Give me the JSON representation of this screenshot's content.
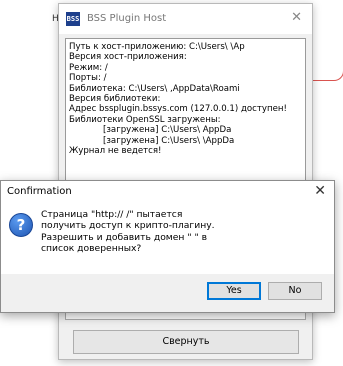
{
  "background": {
    "fragment_text": "Н"
  },
  "host": {
    "title": "BSS Plugin Host",
    "logo_text": "BSS",
    "log_lines": [
      "Путь к хост-приложению: C:\\Users\\             \\Ap",
      "Версия хост-приложения:",
      "Режим:      /",
      "Порты:      /",
      "Библиотека: C:\\Users\\                 ,AppData\\Roami",
      "Версия библиотеки:",
      "Адрес bssplugin.bssys.com (127.0.0.1) доступен!",
      "Библиотеки OpenSSL загружены:",
      "[загружена] C:\\Users\\                   AppDa",
      "[загружена] C:\\Users\\                  \\AppDa",
      "Журнал не ведется!"
    ],
    "collapse_label": "Свернуть"
  },
  "dialog": {
    "title": "Confirmation",
    "text_lines": [
      "Страница \"http://                          /\" пытается",
      "получить доступ к крипто-плагину.",
      "Разрешить и добавить домен \"                        \" в",
      "список доверенных?"
    ],
    "yes_label": "Yes",
    "no_label": "No"
  },
  "icons": {
    "close": "✕",
    "question": "?"
  },
  "colors": {
    "accent": "#0078d7",
    "logo_bg": "#1d3f8c",
    "bg_red_line": "#d9534f"
  }
}
